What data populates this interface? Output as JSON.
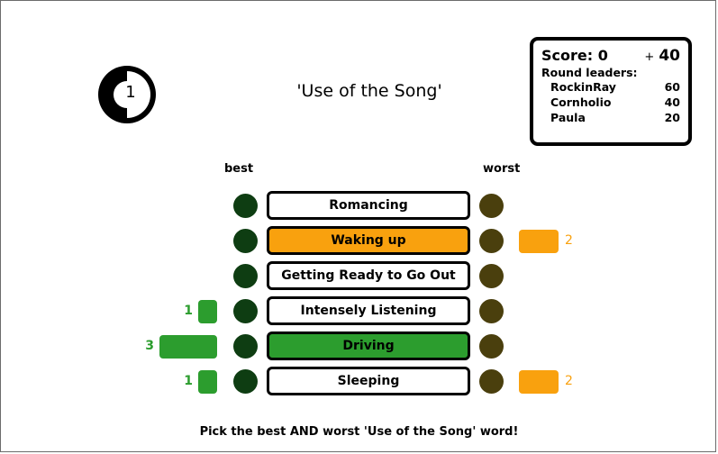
{
  "timer": {
    "value": "1",
    "fraction_remaining": 0.5
  },
  "round_title": "'Use of the Song'",
  "score": {
    "label": "Score: 0",
    "plus": "+",
    "delta": "40",
    "leaders_title": "Round leaders:",
    "leaders": [
      {
        "name": "RockinRay",
        "points": "60"
      },
      {
        "name": "Cornholio",
        "points": "40"
      },
      {
        "name": "Paula",
        "points": "20"
      }
    ]
  },
  "columns": {
    "best": "best",
    "worst": "worst"
  },
  "words": [
    {
      "label": "Romancing",
      "highlight": "none",
      "best_votes": "",
      "worst_votes": ""
    },
    {
      "label": "Waking up",
      "highlight": "orange",
      "best_votes": "",
      "worst_votes": "2"
    },
    {
      "label": "Getting Ready to Go Out",
      "highlight": "none",
      "best_votes": "",
      "worst_votes": ""
    },
    {
      "label": "Intensely Listening",
      "highlight": "none",
      "best_votes": "1",
      "worst_votes": ""
    },
    {
      "label": "Driving",
      "highlight": "green",
      "best_votes": "3",
      "worst_votes": ""
    },
    {
      "label": "Sleeping",
      "highlight": "none",
      "best_votes": "1",
      "worst_votes": "2"
    }
  ],
  "instruction": "Pick the best AND worst 'Use of the Song' word!",
  "colors": {
    "best_green": "#2c9d2e",
    "worst_orange": "#f9a10e",
    "best_dot": "#0e3d12",
    "worst_dot": "#4a3f0d"
  }
}
